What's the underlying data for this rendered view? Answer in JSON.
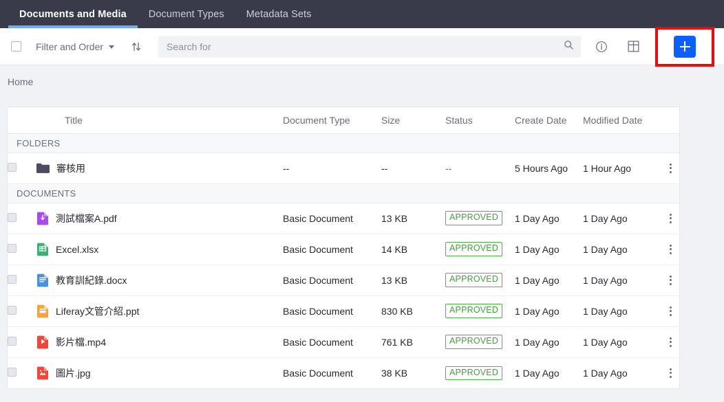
{
  "nav": {
    "tabs": [
      {
        "label": "Documents and Media",
        "active": true
      },
      {
        "label": "Document Types",
        "active": false
      },
      {
        "label": "Metadata Sets",
        "active": false
      }
    ]
  },
  "toolbar": {
    "select_all_checkbox": "",
    "filter_label": "Filter and Order",
    "sort_icon": "sort-up-down-icon",
    "search": {
      "value": "",
      "placeholder": "Search for"
    },
    "search_icon": "search-icon",
    "info_icon": "info-circle-icon",
    "grid_icon": "grid-view-icon",
    "add_label": "+",
    "add_icon": "plus-icon",
    "highlight_color": "#ED0A0A",
    "accent_color": "#0B5FFF"
  },
  "breadcrumb": {
    "home": "Home"
  },
  "table": {
    "columns": [
      "",
      "Title",
      "Document Type",
      "Size",
      "Status",
      "Create Date",
      "Modified Date",
      ""
    ],
    "groups": [
      {
        "label": "FOLDERS",
        "rows": [
          {
            "icon": "folder-icon",
            "title": "審核用",
            "type": "--",
            "size": "--",
            "status": "--",
            "status_badge": false,
            "create_date": "5 Hours Ago",
            "modified_date": "1 Hour Ago"
          }
        ]
      },
      {
        "label": "DOCUMENTS",
        "rows": [
          {
            "icon": "pdf-file-icon",
            "icon_color": "#A84BEB",
            "title": "測試檔案A.pdf",
            "type": "Basic Document",
            "size": "13 KB",
            "status": "APPROVED",
            "status_badge": true,
            "create_date": "1 Day Ago",
            "modified_date": "1 Day Ago"
          },
          {
            "icon": "spreadsheet-file-icon",
            "icon_color": "#3BB273",
            "title": "Excel.xlsx",
            "type": "Basic Document",
            "size": "14 KB",
            "status": "APPROVED",
            "status_badge": true,
            "create_date": "1 Day Ago",
            "modified_date": "1 Day Ago"
          },
          {
            "icon": "word-file-icon",
            "icon_color": "#4A90E2",
            "title": "教育訓紀錄.docx",
            "type": "Basic Document",
            "size": "13 KB",
            "status": "APPROVED",
            "status_badge": true,
            "create_date": "1 Day Ago",
            "modified_date": "1 Day Ago"
          },
          {
            "icon": "presentation-file-icon",
            "icon_color": "#F5A33C",
            "title": "Liferay文管介紹.ppt",
            "type": "Basic Document",
            "size": "830 KB",
            "status": "APPROVED",
            "status_badge": true,
            "create_date": "1 Day Ago",
            "modified_date": "1 Day Ago"
          },
          {
            "icon": "video-file-icon",
            "icon_color": "#F2463A",
            "title": "影片檔.mp4",
            "type": "Basic Document",
            "size": "761 KB",
            "status": "APPROVED",
            "status_badge": true,
            "create_date": "1 Day Ago",
            "modified_date": "1 Day Ago"
          },
          {
            "icon": "image-file-icon",
            "icon_color": "#F2463A",
            "title": "圖片.jpg",
            "type": "Basic Document",
            "size": "38 KB",
            "status": "APPROVED",
            "status_badge": true,
            "create_date": "1 Day Ago",
            "modified_date": "1 Day Ago"
          }
        ]
      }
    ]
  }
}
